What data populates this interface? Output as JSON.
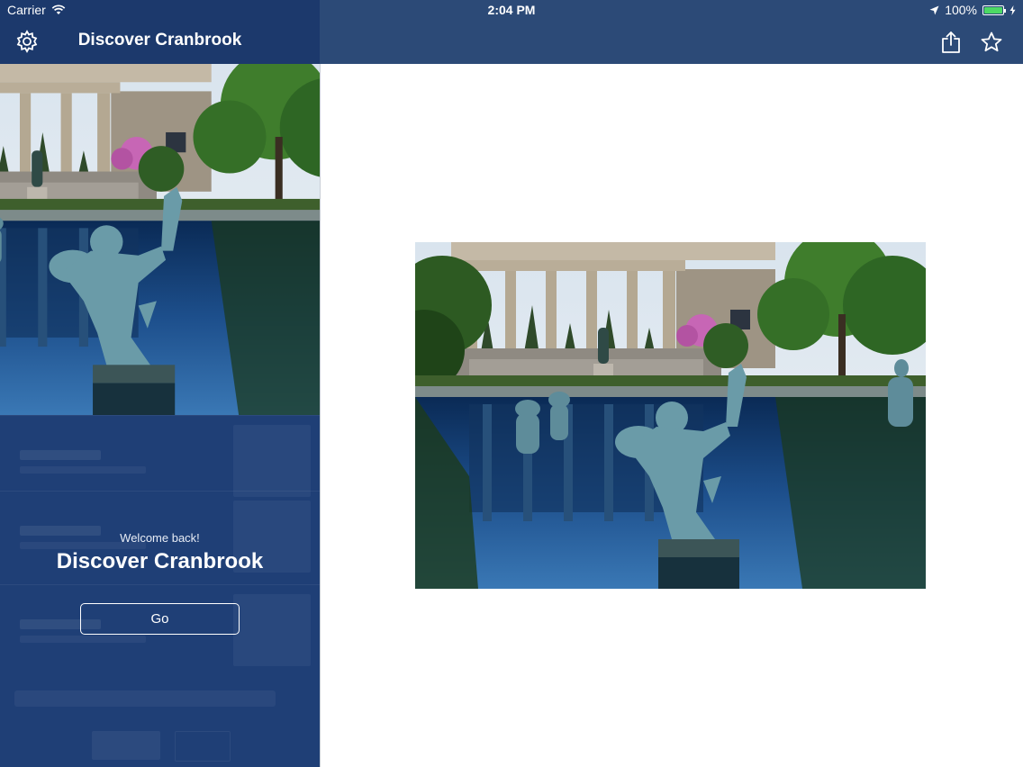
{
  "status_bar": {
    "carrier": "Carrier",
    "time": "2:04 PM",
    "battery": "100%",
    "battery_level": 1.0,
    "icons": [
      "wifi-icon",
      "location-arrow-icon",
      "battery-icon",
      "charging-bolt-icon"
    ]
  },
  "sidebar": {
    "title": "Discover Cranbrook",
    "settings_icon": "gear-icon",
    "photo": "museum-fountain-photo"
  },
  "welcome": {
    "greeting": "Welcome back!",
    "title": "Discover Cranbrook",
    "go_label": "Go"
  },
  "toolbar": {
    "share_icon": "share-icon",
    "favorite_icon": "star-icon"
  },
  "main": {
    "photo": "museum-fountain-photo"
  },
  "colors": {
    "sidebar_bg": "#1f3f76",
    "sidebar_nav": "#1c396c",
    "main_nav": "#2c4a77",
    "battery_green": "#4cd964"
  }
}
